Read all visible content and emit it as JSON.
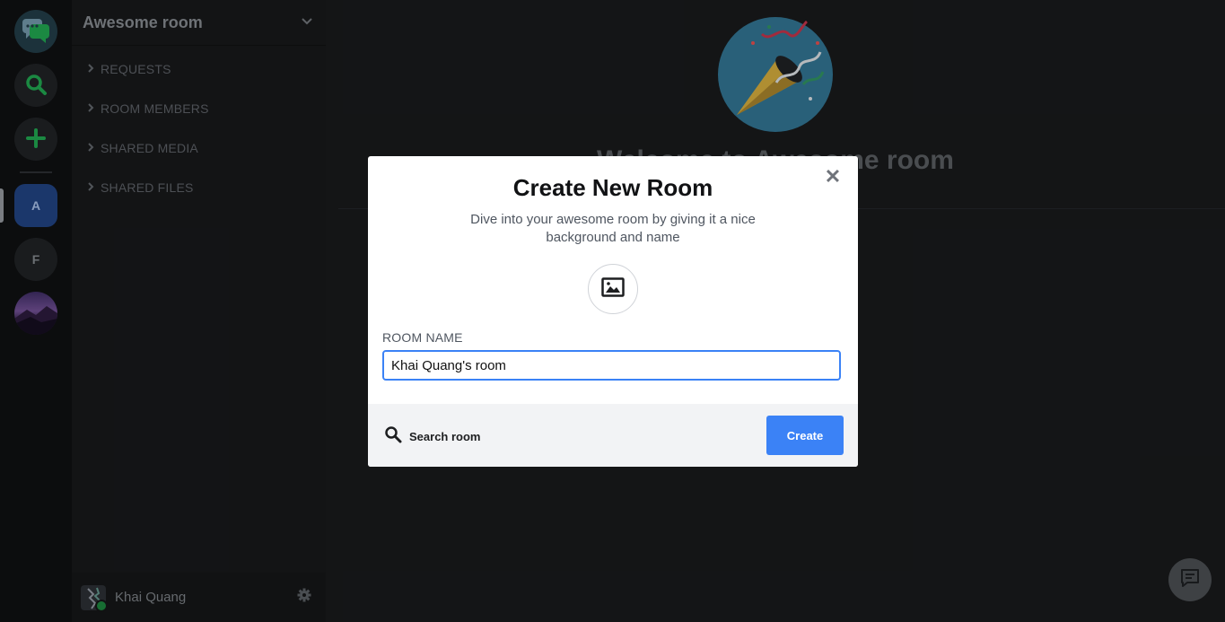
{
  "rail": {
    "items": [
      {
        "name": "home",
        "icon": "chat-bubbles-icon"
      },
      {
        "name": "explore",
        "icon": "search-icon"
      },
      {
        "name": "add-server",
        "icon": "plus-icon"
      },
      {
        "name": "server-a",
        "label": "A"
      },
      {
        "name": "server-f",
        "label": "F"
      },
      {
        "name": "server-image",
        "icon": "landscape-avatar"
      }
    ],
    "accent_green": "#1f9d4c",
    "active_color": "#1f3f7a"
  },
  "sidebar": {
    "room_name": "Awesome room",
    "sections": [
      {
        "label": "REQUESTS"
      },
      {
        "label": "ROOM MEMBERS"
      },
      {
        "label": "SHARED MEDIA"
      },
      {
        "label": "SHARED FILES"
      }
    ],
    "user": {
      "name": "Khai Quang",
      "status": "online"
    }
  },
  "main": {
    "welcome_title": "Welcome to Awesome room",
    "hero_icon": "party-popper-icon"
  },
  "modal": {
    "title": "Create New Room",
    "subtitle": "Dive into your awesome room by giving it a nice background and name",
    "field_label": "ROOM NAME",
    "room_name_value": "Khai Quang's room",
    "search_label": "Search room",
    "create_label": "Create",
    "primary_color": "#3b82f6"
  }
}
